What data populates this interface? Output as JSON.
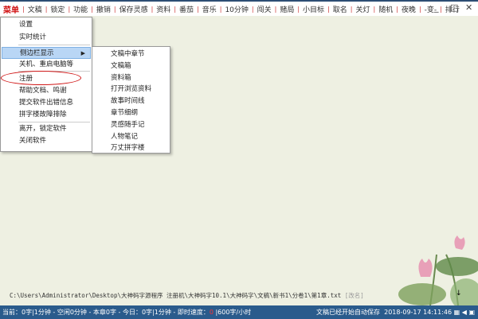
{
  "menubar": [
    "菜单",
    "文稿",
    "锁定",
    "功能",
    "撤销",
    "保存灵感",
    "资料",
    "番茄",
    "音乐",
    "10分钟",
    "闯关",
    "赌局",
    "小目标",
    "取名",
    "关灯",
    "随机",
    "夜晚",
    "-变-",
    "排行"
  ],
  "window_controls": {
    "minimize": "_",
    "maximize": "□",
    "close": "✕"
  },
  "main_menu": [
    "设置",
    "实时统计",
    "侧边栏显示",
    "关机、重启电脑等",
    "注册",
    "帮助文档、鸣谢",
    "提交软件出错信息",
    "拼字楼故障排除",
    "离开，锁定软件",
    "关闭软件"
  ],
  "sub_menu": [
    "文稿中章节",
    "文稿箱",
    "资料箱",
    "打开浏览资料",
    "故事时间线",
    "章节细纲",
    "灵感随手记",
    "人物笔记",
    "万丈拼字楼"
  ],
  "file_path": "C:\\Users\\Administrator\\Desktop\\大神码字源程序 注册机\\大神码字10.1\\大神码字\\文稿\\新书1\\分卷1\\第1章.txt",
  "rename": "[改名]",
  "scroll_arrow": "↓",
  "status": {
    "left": "当前：0字|1分钟 - 空闲0分钟 - 本章0字 - 今日：0字|1分钟 - 即时速度：",
    "speed": "0",
    "rate": "|600字/小时",
    "autosave": "文稿已经开始自动保存",
    "datetime": "2018-09-17 14:11:46"
  },
  "colors": {
    "accent": "#d01010",
    "status_bar": "#2a5b8c",
    "highlight": "#b9d6f5"
  }
}
